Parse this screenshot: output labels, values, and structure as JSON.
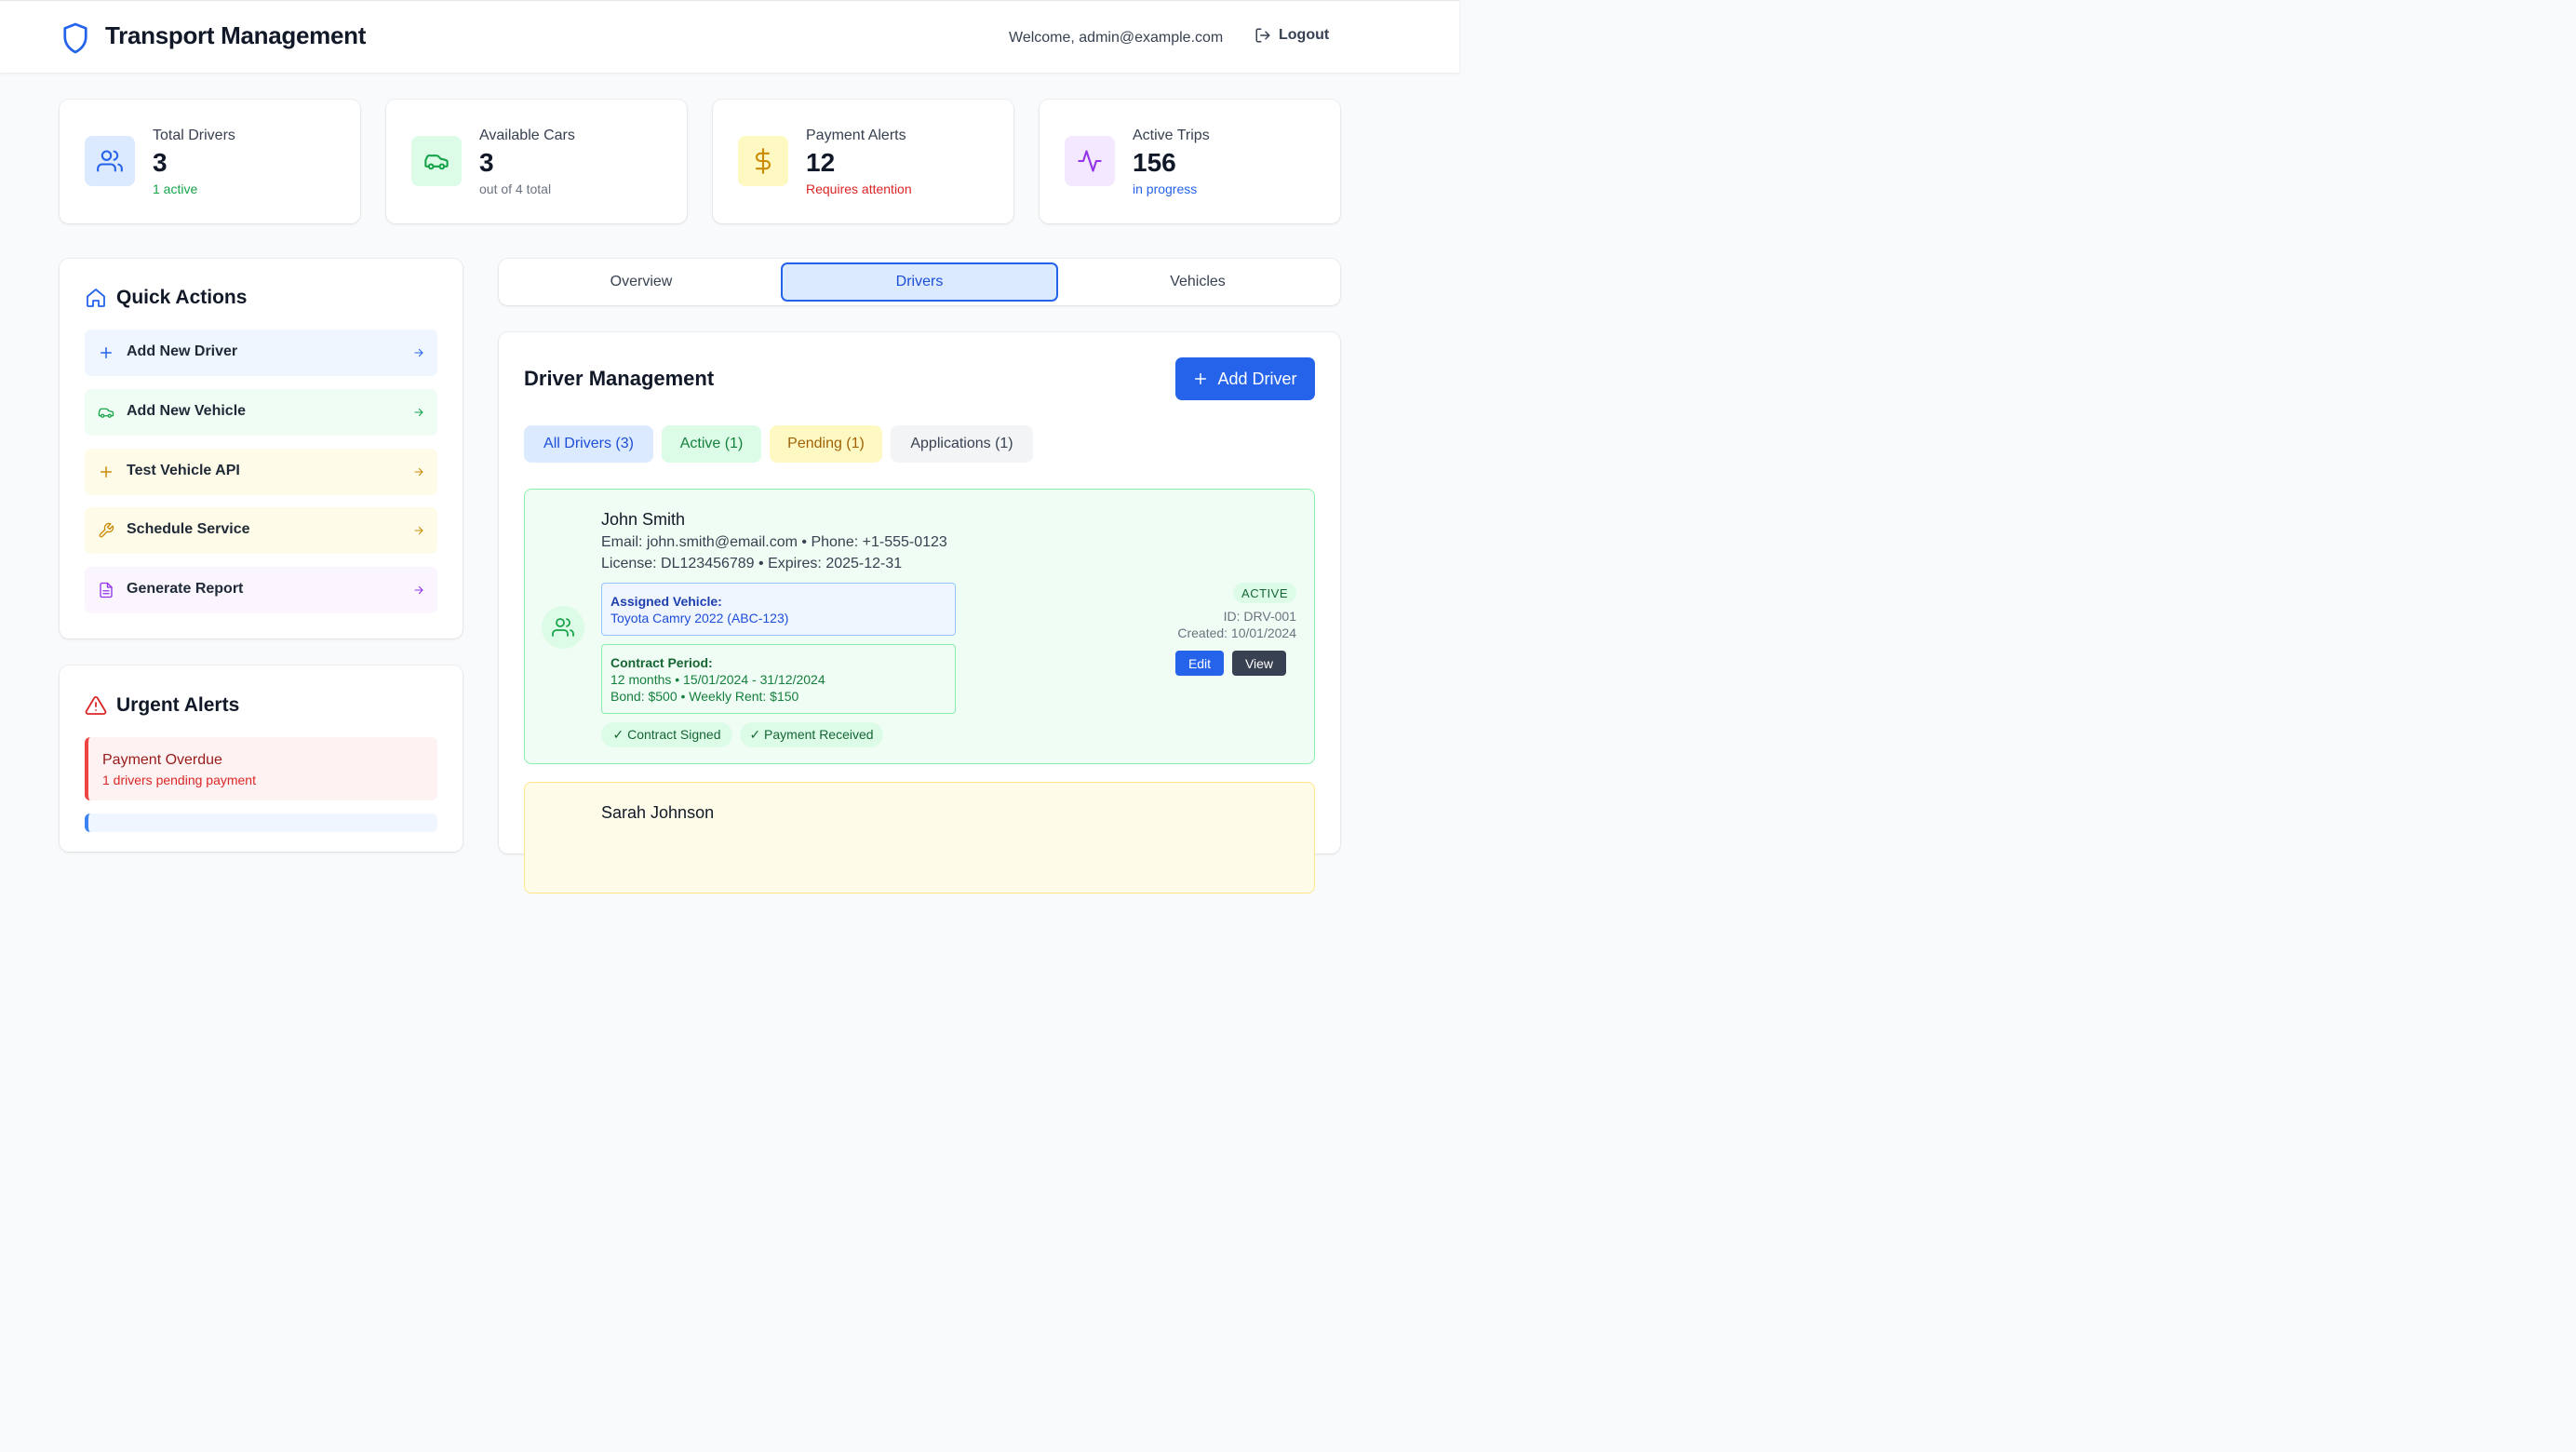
{
  "header": {
    "title": "Transport Management",
    "welcome": "Welcome, admin@example.com",
    "logout_label": "Logout"
  },
  "stats": [
    {
      "label": "Total Drivers",
      "value": "3",
      "sub": "1 active",
      "sub_color": "#16a34a",
      "icon": "users-icon",
      "icon_bg": "#dbeafe"
    },
    {
      "label": "Available Cars",
      "value": "3",
      "sub": "out of 4 total",
      "sub_color": "#6b7280",
      "icon": "car-icon",
      "icon_bg": "#dcfce7"
    },
    {
      "label": "Payment Alerts",
      "value": "12",
      "sub": "Requires attention",
      "sub_color": "#dc2626",
      "icon": "dollar-icon",
      "icon_bg": "#fef9c3"
    },
    {
      "label": "Active Trips",
      "value": "156",
      "sub": "in progress",
      "sub_color": "#2563eb",
      "icon": "activity-icon",
      "icon_bg": "#f3e8ff"
    }
  ],
  "quick_actions": {
    "title": "Quick Actions",
    "items": [
      {
        "label": "Add New Driver",
        "icon": "plus-icon",
        "bg": "#eff6ff",
        "color": "#2563eb"
      },
      {
        "label": "Add New Vehicle",
        "icon": "car-icon",
        "bg": "#f0fdf4",
        "color": "#16a34a"
      },
      {
        "label": "Test Vehicle API",
        "icon": "plus-icon",
        "bg": "#fefce8",
        "color": "#ca8a04"
      },
      {
        "label": "Schedule Service",
        "icon": "wrench-icon",
        "bg": "#fefce8",
        "color": "#ca8a04"
      },
      {
        "label": "Generate Report",
        "icon": "document-icon",
        "bg": "#faf5ff",
        "color": "#9333ea"
      }
    ]
  },
  "urgent_alerts": {
    "title": "Urgent Alerts",
    "items": [
      {
        "title": "Payment Overdue",
        "subtitle": "1 drivers pending payment"
      }
    ]
  },
  "tabs": [
    {
      "label": "Overview",
      "active": false
    },
    {
      "label": "Drivers",
      "active": true
    },
    {
      "label": "Vehicles",
      "active": false
    }
  ],
  "driver_management": {
    "title": "Driver Management",
    "add_label": "Add Driver",
    "filters": [
      {
        "label": "All Drivers (3)",
        "bg": "#dbeafe",
        "color": "#1d4ed8"
      },
      {
        "label": "Active (1)",
        "bg": "#dcfce7",
        "color": "#15803d"
      },
      {
        "label": "Pending (1)",
        "bg": "#fef9c3",
        "color": "#a16207"
      },
      {
        "label": "Applications (1)",
        "bg": "#f3f4f6",
        "color": "#374151"
      }
    ],
    "drivers": [
      {
        "name": "John Smith",
        "contact": "Email: john.smith@email.com • Phone: +1-555-0123",
        "license": "License: DL123456789 • Expires: 2025-12-31",
        "vehicle_heading": "Assigned Vehicle:",
        "vehicle": "Toyota Camry 2022 (ABC-123)",
        "contract_heading": "Contract Period:",
        "contract_period": "12 months • 15/01/2024 - 31/12/2024",
        "contract_money": "Bond: $500 • Weekly Rent: $150",
        "chips": [
          "✓ Contract Signed",
          "✓ Payment Received"
        ],
        "status": "ACTIVE",
        "id": "ID: DRV-001",
        "created": "Created: 10/01/2024",
        "edit_label": "Edit",
        "view_label": "View"
      },
      {
        "name": "Sarah Johnson"
      }
    ]
  }
}
